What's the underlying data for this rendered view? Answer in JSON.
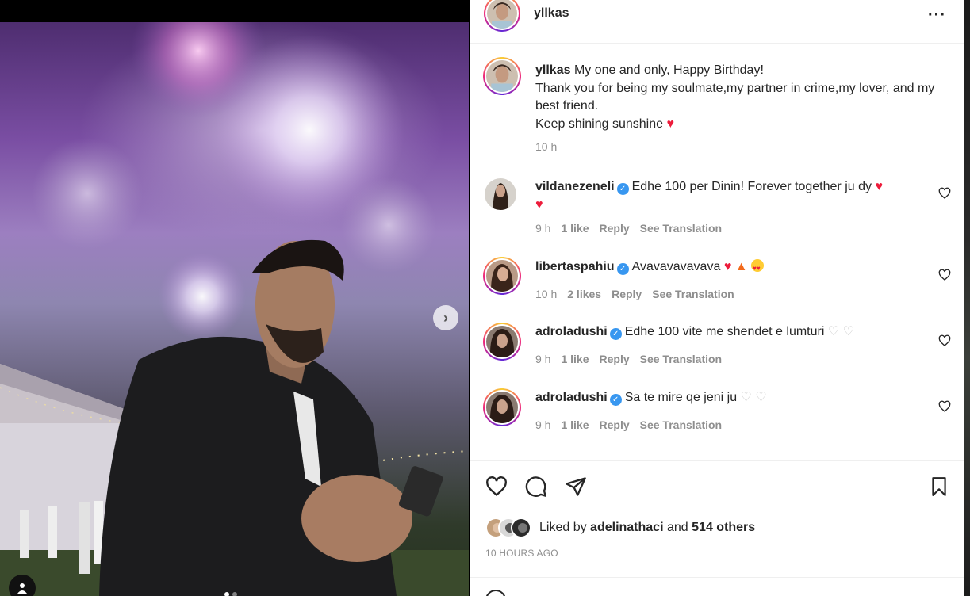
{
  "post": {
    "author": "yllkas",
    "more_icon": "···",
    "caption_lines": [
      "My one and only, Happy Birthday!",
      "Thank you for being my soulmate,my partner in crime,my lover, and my best friend.",
      "Keep shining sunshine"
    ],
    "caption_time": "10 h",
    "photo": {
      "next_icon": "›",
      "carousel_dots": 2,
      "active_dot": 0
    }
  },
  "comments": [
    {
      "username": "vildanezeneli",
      "verified": true,
      "text": "Edhe 100 per Dinin! Forever together ju dy",
      "emojis": "red-heart red-heart",
      "time": "9 h",
      "likes": "1 like",
      "reply": "Reply",
      "translate": "See Translation"
    },
    {
      "username": "libertaspahiu",
      "verified": true,
      "text": "Avavavavavava",
      "emojis": "red-heart fire heart-eyes",
      "time": "10 h",
      "likes": "2 likes",
      "reply": "Reply",
      "translate": "See Translation"
    },
    {
      "username": "adroladushi",
      "verified": true,
      "text": "Edhe 100 vite me shendet e lumturi",
      "emojis": "white-heart white-heart",
      "time": "9 h",
      "likes": "1 like",
      "reply": "Reply",
      "translate": "See Translation"
    },
    {
      "username": "adroladushi",
      "verified": true,
      "text": "Sa te mire qe jeni ju",
      "emojis": "white-heart white-heart",
      "time": "9 h",
      "likes": "1 like",
      "reply": "Reply",
      "translate": "See Translation"
    }
  ],
  "likes": {
    "prefix": "Liked by",
    "user": "adelinathaci",
    "and": "and",
    "others": "514 others"
  },
  "post_time": "10 HOURS AGO",
  "colors": {
    "text": "#262626",
    "muted": "#8e8e8e",
    "verified": "#3897f0",
    "heart": "#ed1c3b"
  }
}
